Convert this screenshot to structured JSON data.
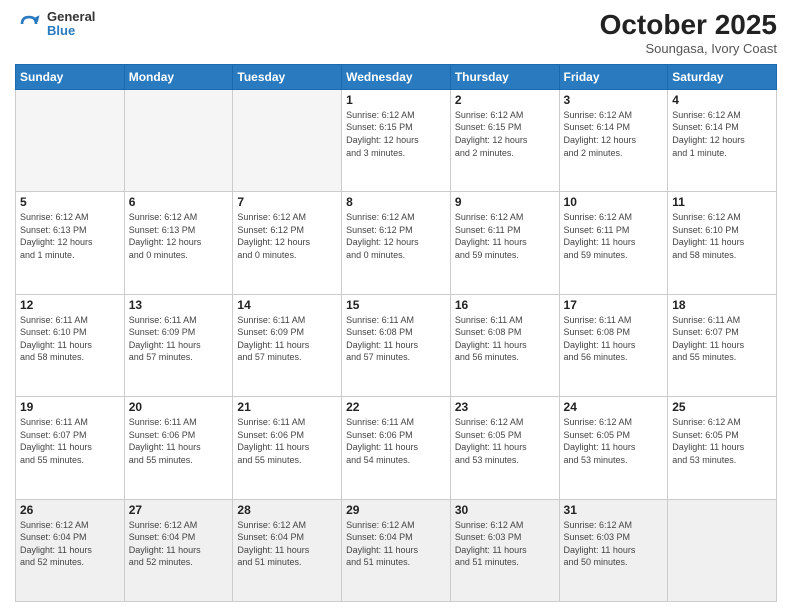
{
  "header": {
    "logo": {
      "line1": "General",
      "line2": "Blue"
    },
    "title": "October 2025",
    "subtitle": "Soungasa, Ivory Coast"
  },
  "weekdays": [
    "Sunday",
    "Monday",
    "Tuesday",
    "Wednesday",
    "Thursday",
    "Friday",
    "Saturday"
  ],
  "weeks": [
    [
      {
        "day": "",
        "info": ""
      },
      {
        "day": "",
        "info": ""
      },
      {
        "day": "",
        "info": ""
      },
      {
        "day": "1",
        "info": "Sunrise: 6:12 AM\nSunset: 6:15 PM\nDaylight: 12 hours\nand 3 minutes."
      },
      {
        "day": "2",
        "info": "Sunrise: 6:12 AM\nSunset: 6:15 PM\nDaylight: 12 hours\nand 2 minutes."
      },
      {
        "day": "3",
        "info": "Sunrise: 6:12 AM\nSunset: 6:14 PM\nDaylight: 12 hours\nand 2 minutes."
      },
      {
        "day": "4",
        "info": "Sunrise: 6:12 AM\nSunset: 6:14 PM\nDaylight: 12 hours\nand 1 minute."
      }
    ],
    [
      {
        "day": "5",
        "info": "Sunrise: 6:12 AM\nSunset: 6:13 PM\nDaylight: 12 hours\nand 1 minute."
      },
      {
        "day": "6",
        "info": "Sunrise: 6:12 AM\nSunset: 6:13 PM\nDaylight: 12 hours\nand 0 minutes."
      },
      {
        "day": "7",
        "info": "Sunrise: 6:12 AM\nSunset: 6:12 PM\nDaylight: 12 hours\nand 0 minutes."
      },
      {
        "day": "8",
        "info": "Sunrise: 6:12 AM\nSunset: 6:12 PM\nDaylight: 12 hours\nand 0 minutes."
      },
      {
        "day": "9",
        "info": "Sunrise: 6:12 AM\nSunset: 6:11 PM\nDaylight: 11 hours\nand 59 minutes."
      },
      {
        "day": "10",
        "info": "Sunrise: 6:12 AM\nSunset: 6:11 PM\nDaylight: 11 hours\nand 59 minutes."
      },
      {
        "day": "11",
        "info": "Sunrise: 6:12 AM\nSunset: 6:10 PM\nDaylight: 11 hours\nand 58 minutes."
      }
    ],
    [
      {
        "day": "12",
        "info": "Sunrise: 6:11 AM\nSunset: 6:10 PM\nDaylight: 11 hours\nand 58 minutes."
      },
      {
        "day": "13",
        "info": "Sunrise: 6:11 AM\nSunset: 6:09 PM\nDaylight: 11 hours\nand 57 minutes."
      },
      {
        "day": "14",
        "info": "Sunrise: 6:11 AM\nSunset: 6:09 PM\nDaylight: 11 hours\nand 57 minutes."
      },
      {
        "day": "15",
        "info": "Sunrise: 6:11 AM\nSunset: 6:08 PM\nDaylight: 11 hours\nand 57 minutes."
      },
      {
        "day": "16",
        "info": "Sunrise: 6:11 AM\nSunset: 6:08 PM\nDaylight: 11 hours\nand 56 minutes."
      },
      {
        "day": "17",
        "info": "Sunrise: 6:11 AM\nSunset: 6:08 PM\nDaylight: 11 hours\nand 56 minutes."
      },
      {
        "day": "18",
        "info": "Sunrise: 6:11 AM\nSunset: 6:07 PM\nDaylight: 11 hours\nand 55 minutes."
      }
    ],
    [
      {
        "day": "19",
        "info": "Sunrise: 6:11 AM\nSunset: 6:07 PM\nDaylight: 11 hours\nand 55 minutes."
      },
      {
        "day": "20",
        "info": "Sunrise: 6:11 AM\nSunset: 6:06 PM\nDaylight: 11 hours\nand 55 minutes."
      },
      {
        "day": "21",
        "info": "Sunrise: 6:11 AM\nSunset: 6:06 PM\nDaylight: 11 hours\nand 55 minutes."
      },
      {
        "day": "22",
        "info": "Sunrise: 6:11 AM\nSunset: 6:06 PM\nDaylight: 11 hours\nand 54 minutes."
      },
      {
        "day": "23",
        "info": "Sunrise: 6:12 AM\nSunset: 6:05 PM\nDaylight: 11 hours\nand 53 minutes."
      },
      {
        "day": "24",
        "info": "Sunrise: 6:12 AM\nSunset: 6:05 PM\nDaylight: 11 hours\nand 53 minutes."
      },
      {
        "day": "25",
        "info": "Sunrise: 6:12 AM\nSunset: 6:05 PM\nDaylight: 11 hours\nand 53 minutes."
      }
    ],
    [
      {
        "day": "26",
        "info": "Sunrise: 6:12 AM\nSunset: 6:04 PM\nDaylight: 11 hours\nand 52 minutes."
      },
      {
        "day": "27",
        "info": "Sunrise: 6:12 AM\nSunset: 6:04 PM\nDaylight: 11 hours\nand 52 minutes."
      },
      {
        "day": "28",
        "info": "Sunrise: 6:12 AM\nSunset: 6:04 PM\nDaylight: 11 hours\nand 51 minutes."
      },
      {
        "day": "29",
        "info": "Sunrise: 6:12 AM\nSunset: 6:04 PM\nDaylight: 11 hours\nand 51 minutes."
      },
      {
        "day": "30",
        "info": "Sunrise: 6:12 AM\nSunset: 6:03 PM\nDaylight: 11 hours\nand 51 minutes."
      },
      {
        "day": "31",
        "info": "Sunrise: 6:12 AM\nSunset: 6:03 PM\nDaylight: 11 hours\nand 50 minutes."
      },
      {
        "day": "",
        "info": ""
      }
    ]
  ]
}
